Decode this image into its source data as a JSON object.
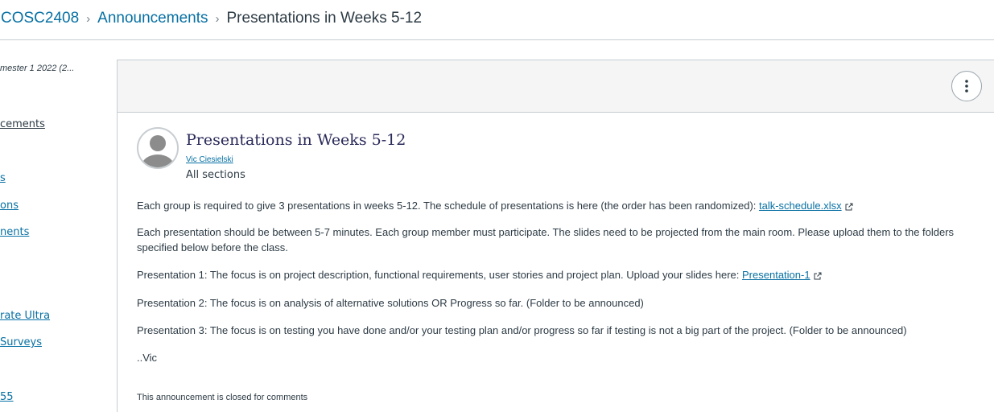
{
  "breadcrumb": {
    "course": "COSC2408",
    "section": "Announcements",
    "current": "Presentations in Weeks 5-12"
  },
  "sidebar": {
    "term": "mester 1 2022 (2...",
    "items": [
      {
        "label": "cements",
        "active": true
      },
      {
        "label": "s",
        "active": false
      },
      {
        "label": "ons",
        "active": false
      },
      {
        "label": "nents",
        "active": false
      },
      {
        "label": "rate Ultra",
        "active": false
      },
      {
        "label": "Surveys",
        "active": false
      },
      {
        "label": "55",
        "active": false
      }
    ]
  },
  "toolbar": {
    "more_icon": "more-vertical-icon"
  },
  "announcement": {
    "title": "Presentations in Weeks 5-12",
    "author": "Vic Ciesielski",
    "sections": "All sections",
    "avatar_icon": "user-avatar-icon",
    "p1_text": "Each group is required to give 3 presentations in weeks 5-12.   The schedule of presentations is here (the order has been randomized): ",
    "p1_link": "talk-schedule.xlsx",
    "p2_text": "Each presentation should be between 5-7 minutes.  Each group member must participate.  The slides need to be projected from the main room.  Please upload them to the folders specified below before the class.",
    "p3_text": "Presentation 1:  The focus is on project description, functional requirements, user stories and project plan.  Upload your slides here: ",
    "p3_link": "Presentation-1",
    "p4_text": "Presentation 2:  The focus is on analysis of alternative solutions OR Progress so far.  (Folder to be announced)",
    "p5_text": "Presentation 3: The focus is on testing you have done and/or your testing plan and/or progress so far if testing is not a big part of the project. (Folder to be announced)",
    "signature": "..Vic",
    "closed_note": "This announcement is closed for comments"
  },
  "colors": {
    "link": "#0770a3",
    "text": "#2d3b45",
    "toolbar_bg": "#f5f5f5",
    "title": "#2a2a5a"
  }
}
